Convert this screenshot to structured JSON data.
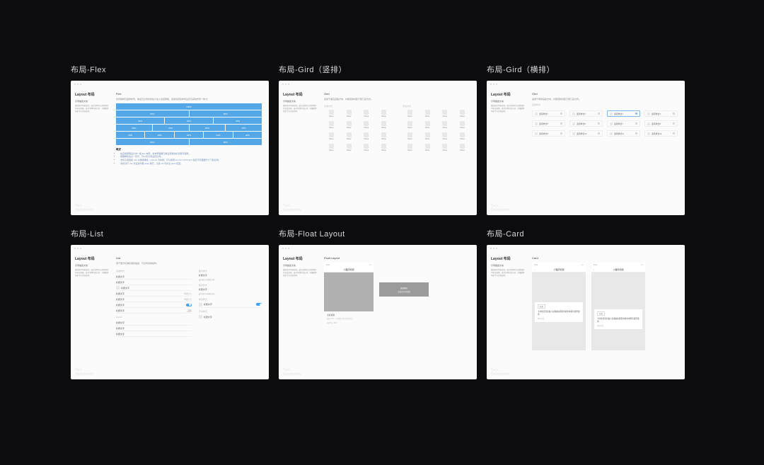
{
  "titles": {
    "flex": "布局-Flex",
    "grid_v": "布局-Gird（竖排）",
    "grid_h": "布局-Gird（横排）",
    "list": "布局-List",
    "float": "布局-Float Layout",
    "card": "布局-Card"
  },
  "common": {
    "page_title": "Layout 布局",
    "side_sub": "示例描述文案",
    "side_para": "横排类示列表格式，结合使用可以获得更好的布局效果，支持多种布局方式，详细配置项见下方文档说明。",
    "watermark_1": "Taro",
    "watermark_2": "Styleguides"
  },
  "flex": {
    "section": "Flex",
    "desc": "支持横排及竖排布局，等宽及比例支持最大最小宽度限制，适用性视窗参考设定及其他布局一体分！",
    "rows": [
      [
        "100%"
      ],
      [
        "50%",
        "50%"
      ],
      [
        "33%",
        "33%",
        "33%"
      ],
      [
        "25%",
        "25%",
        "25%",
        "25%"
      ],
      [
        "20%",
        "20%",
        "20%",
        "20%",
        "20%"
      ],
      [
        "50%",
        "50%"
      ]
    ],
    "note_h": "概述",
    "notes": [
      "在应用逻辑设计中一般 flex 布局，将布局容器元素设置属性标识即可使用；",
      "容器弹性会占一份分，可以对子项设定比例；",
      "支持子级层级 row 以横排排版，column 为纵排；可以使用 sm=12 md=6 lg=4 指定不同容器尺寸下的比例；",
      "支持分行 row 可设替代器 wrap 换行，子级 col 可补全 span 配置。"
    ]
  },
  "grid_v": {
    "section": "Gird",
    "desc": "适用于垂直宫格方向，并能控制间距不限几宫方式。",
    "left_h": "标准方式",
    "right_h": "紧凑方式",
    "item_label": "Name"
  },
  "grid_h": {
    "section": "Gird",
    "desc": "适用于横排宫格方向，并能控制间距不限几宫方式。",
    "row_h": "选择样式",
    "labels": [
      "选项样式1",
      "选项样式2",
      "选项样式3",
      "选项样式4",
      "选项样式5",
      "选项样式6",
      "选项样式7",
      "选项样式8",
      "选项样式9",
      "选项样式10",
      "选项样式11",
      "选项样式12"
    ]
  },
  "list": {
    "section": "List",
    "desc": "用于展示标准标题和描述，可支持选择操作。",
    "group1_h": "基础样式",
    "group2_h": "Switch",
    "item_label": "标题文字",
    "val_label": "详细信息",
    "right_h1": "图文样式",
    "right_item": "标题文字",
    "right_spec": "支持自定义模块方式",
    "right_h2": "图文样式",
    "radio_h": "单选样式",
    "switch_h": "开关样式"
  },
  "float": {
    "section": "Float Layout",
    "nav_title": "小程序标题",
    "back": "‹",
    "desc_a": "点此编辑",
    "sheet_b_l1": "底部弹层",
    "sheet_b_l2": "点击空白可关闭",
    "spec_1": "高度 53% — 顶部留白符合视觉对比",
    "spec_2": "高度约占 80%"
  },
  "card": {
    "section": "Card",
    "nav_title": "小程序标题",
    "tag": "标题",
    "text": "卡片样式支持插入标题副标题及内容文本即可组件使用",
    "meta": "附加信息"
  }
}
